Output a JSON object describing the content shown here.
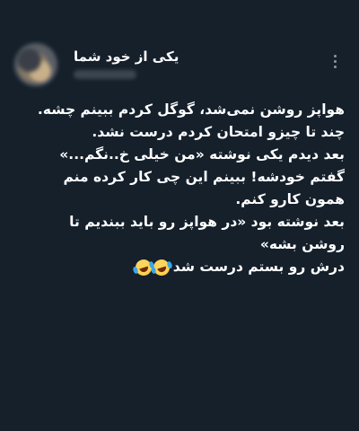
{
  "tweet": {
    "display_name": "یکی از خود شما",
    "more_icon": "more-vertical-icon",
    "lines": [
      "هواپز روشن نمی‌شد، گوگل کردم ببینم چشه.",
      "چند تا چیزو امتحان کردم درست نشد.",
      "بعد دیدم یکی نوشته «من خیلی خ..نگم...»",
      "گفتم خودشه! ببینم این چی کار کرده منم",
      "همون کارو کنم.",
      "بعد نوشته بود «در هواپز رو باید ببندیم تا",
      "روشن بشه»",
      "درش رو بستم درست شد"
    ],
    "emoji": "rolling-on-the-floor-laughing-emoji"
  }
}
